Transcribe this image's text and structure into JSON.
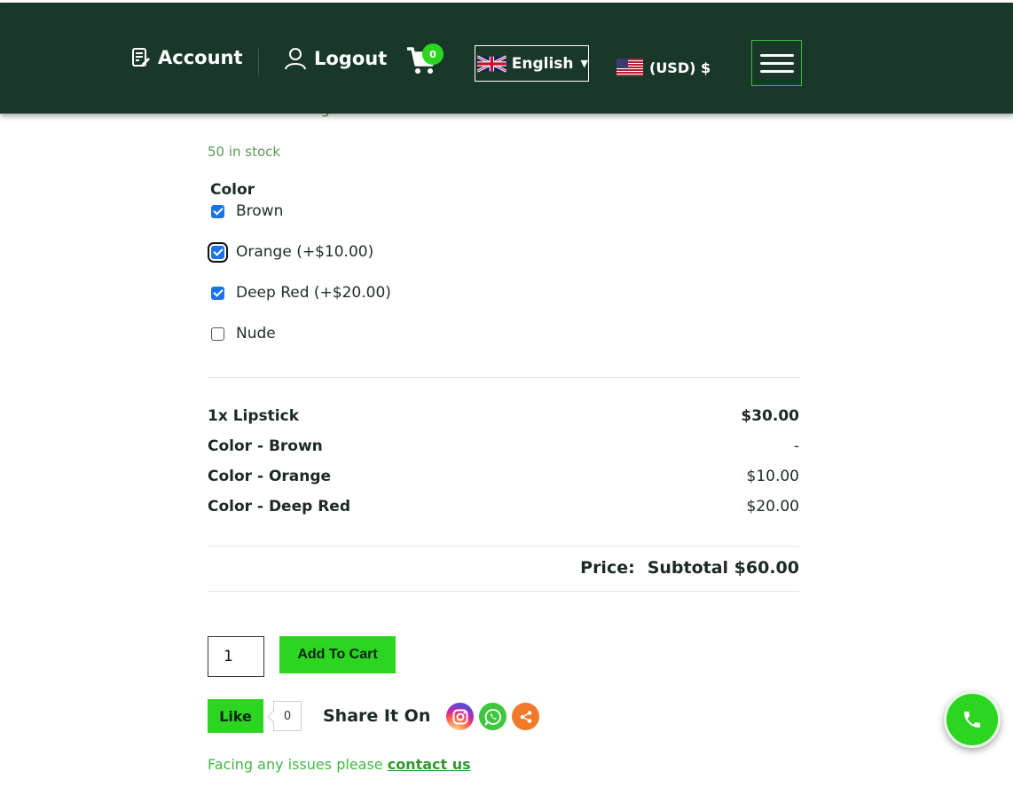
{
  "header": {
    "account_label": "Account",
    "logout_label": "Logout",
    "cart_count": "0",
    "language_label": "English",
    "currency_label": "(USD) $"
  },
  "product": {
    "continue_reading": "Continue reading",
    "stock": "50 in stock",
    "color_title": "Color",
    "options": [
      {
        "label": "Brown",
        "checked": true
      },
      {
        "label": "Orange (+$10.00)",
        "checked": true
      },
      {
        "label": "Deep Red (+$20.00)",
        "checked": true
      },
      {
        "label": "Nude",
        "checked": false
      }
    ]
  },
  "summary": {
    "rows": [
      {
        "label": "1x Lipstick",
        "value": "$30.00"
      },
      {
        "label": "Color - Brown",
        "value": "-"
      },
      {
        "label": "Color - Orange",
        "value": "$10.00"
      },
      {
        "label": "Color - Deep Red",
        "value": "$20.00"
      }
    ],
    "price_label": "Price:",
    "subtotal": "Subtotal $60.00"
  },
  "actions": {
    "quantity": "1",
    "add_to_cart": "Add To Cart",
    "like_label": "Like",
    "like_count": "0",
    "share_label": "Share It On"
  },
  "footer": {
    "issues_text": "Facing any issues please ",
    "contact_link": "contact us"
  },
  "colors": {
    "header_bg": "#19382a",
    "accent_green": "#2cd620",
    "checkbox_blue": "#1a73e8"
  }
}
